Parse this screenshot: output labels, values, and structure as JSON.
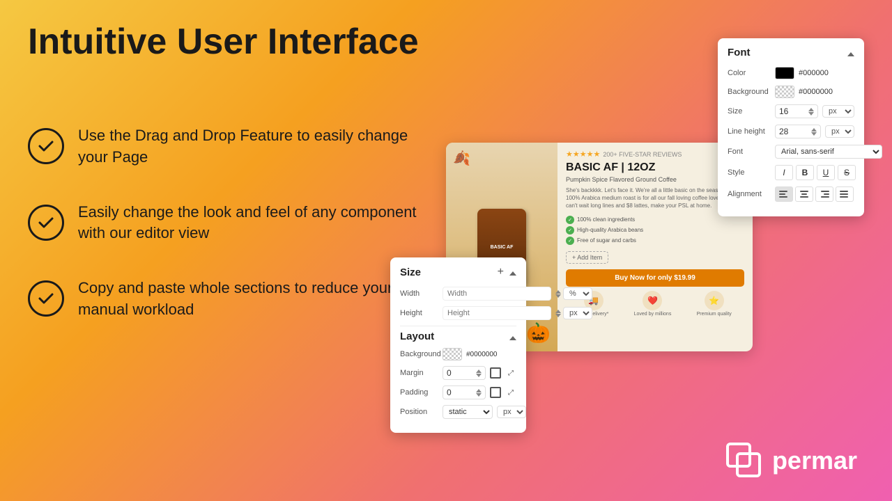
{
  "page": {
    "title": "Intuitive User Interface",
    "background": "gradient yellow to pink"
  },
  "features": [
    {
      "id": 1,
      "text": "Use the Drag and Drop Feature to easily change your Page"
    },
    {
      "id": 2,
      "text": "Easily change the look and feel of any component with our editor view"
    },
    {
      "id": 3,
      "text": "Copy and paste whole sections to reduce your manual workload"
    }
  ],
  "font_panel": {
    "title": "Font",
    "color_label": "Color",
    "color_hex": "#000000",
    "background_label": "Background",
    "background_hex": "#0000000",
    "size_label": "Size",
    "size_value": "16",
    "size_unit": "px",
    "line_height_label": "Line height",
    "line_height_value": "28",
    "line_height_unit": "px",
    "font_label": "Font",
    "font_value": "Arial, sans-serif",
    "style_label": "Style",
    "alignment_label": "Alignment"
  },
  "size_panel": {
    "title": "Size",
    "width_label": "Width",
    "width_placeholder": "Width",
    "width_unit": "%",
    "height_label": "Height",
    "height_placeholder": "Height",
    "height_unit": "px",
    "layout_label": "Layout",
    "background_label": "Background",
    "background_hex": "#0000000",
    "margin_label": "Margin",
    "margin_value": "0",
    "padding_label": "Padding",
    "padding_value": "0",
    "position_label": "Position",
    "position_value": "static",
    "position_unit": "px"
  },
  "product_card": {
    "stars": "★★★★★",
    "review_text": "200+ FIVE-STAR REVIEWS",
    "title": "BASIC AF | 12OZ",
    "subtitle": "Pumpkin Spice Flavored Ground Coffee",
    "description": "She's backkkk. Let's face it. We're all a little basic on the season. This 100% Arabica medium roast is for all our fall loving coffee lovers who can't wait long lines and $8 lattes, make your PSL at home.",
    "bullets": [
      "100% clean ingredients",
      "High-quality Arabica beans",
      "Free of sugar and carbs"
    ],
    "add_item_btn": "+ Add Item",
    "buy_btn": "Buy Now for only $19.99",
    "footer_icons": [
      {
        "icon": "🚚",
        "label": "Free delivery*"
      },
      {
        "icon": "❤️",
        "label": "Loved by millions"
      },
      {
        "icon": "⭐",
        "label": "Premium quality"
      }
    ]
  },
  "permar": {
    "name": "permar"
  }
}
